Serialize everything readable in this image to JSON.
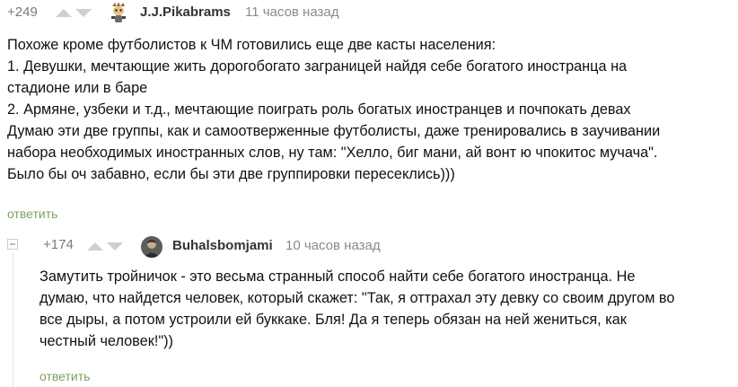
{
  "colors": {
    "reply_link": "#7aa35f",
    "rating_text": "#7a7a7a",
    "vote_arrow": "#cfcfcf",
    "username": "#333333",
    "time": "#8a8a8a",
    "body_text": "#111111"
  },
  "comments": [
    {
      "rating": "+249",
      "username": "J.J.Pikabrams",
      "time": "11 часов назад",
      "avatar_icon": "cartoon-avatar-icon",
      "lines": [
        "Похоже кроме футболистов к ЧМ готовились еще две касты населения:",
        "1. Девушки, мечтающие жить дорогобогато заграницей найдя себе богатого иностранца на",
        "стадионе или в баре",
        "2. Армяне, узбеки и т.д., мечтающие поиграть роль богатых иностранцев и почпокать девах",
        "Думаю эти две группы, как и самоотверженные футболисты, даже тренировались в заучивании",
        "набора необходимых иностранных слов, ну там: \"Хелло, биг мани, ай вонт ю чпокитос мучача\".",
        "Было бы оч забавно, если бы эти две группировки пересеклись)))"
      ],
      "reply_label": "ответить"
    },
    {
      "rating": "+174",
      "username": "Buhalsbomjami",
      "time": "10 часов назад",
      "avatar_icon": "photo-avatar-icon",
      "lines": [
        "Замутить тройничок - это весьма странный способ найти себе богатого иностранца. Не",
        "думаю, что найдется человек, который скажет: \"Так, я оттрахал эту девку со своим другом во",
        "все дыры, а потом устроили ей буккаке. Бля! Да я теперь обязан на ней жениться, как",
        "честный человек!\"))"
      ],
      "reply_label": "ответить"
    }
  ]
}
